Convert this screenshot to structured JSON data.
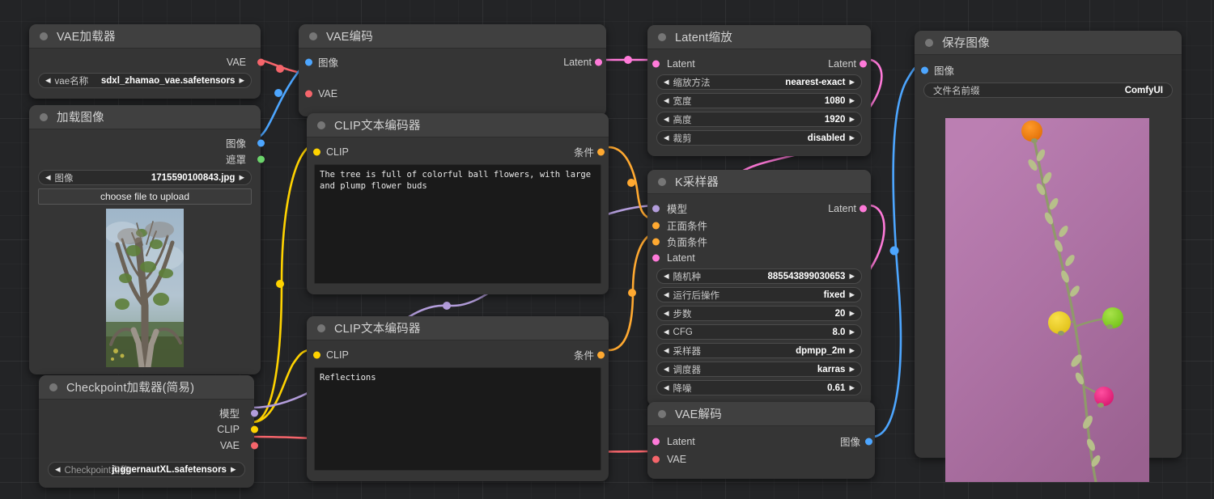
{
  "app": {
    "name": "ComfyUI",
    "canvas_bg": "#232426"
  },
  "colors": {
    "vae_red": "#f5656b",
    "image_blue": "#4da6ff",
    "mask_green": "#6bd46b",
    "latent_pink": "#ff7ad9",
    "clip_yellow": "#ffd300",
    "cond_orange": "#ffa931",
    "model_purple": "#b39ddb"
  },
  "nodes": [
    {
      "id": "vae-loader",
      "title": "VAE加载器",
      "outputs": [
        {
          "label": "VAE",
          "color": "#f5656b"
        }
      ],
      "inputs": [],
      "widgets": [
        {
          "label": "vae名称",
          "value": "sdxl_zhamao_vae.safetensors",
          "arrows": true
        }
      ]
    },
    {
      "id": "load-image",
      "title": "加载图像",
      "outputs": [
        {
          "label": "图像",
          "color": "#4da6ff"
        },
        {
          "label": "遮罩",
          "color": "#6bd46b"
        }
      ],
      "inputs": [],
      "widgets": [
        {
          "label": "图像",
          "value": "1715590100843.jpg",
          "arrows": true
        }
      ],
      "button": "choose file to upload",
      "preview": "tree-photo"
    },
    {
      "id": "checkpoint-loader",
      "title": "Checkpoint加载器(简易)",
      "inputs": [],
      "outputs": [
        {
          "label": "模型",
          "color": "#b39ddb"
        },
        {
          "label": "CLIP",
          "color": "#ffd300"
        },
        {
          "label": "VAE",
          "color": "#f5656b"
        }
      ],
      "widgets": [
        {
          "label": "Checkpoint名称",
          "value": "juggernautXL.safetensors",
          "arrows": true
        }
      ]
    },
    {
      "id": "vae-encode",
      "title": "VAE编码",
      "inputs": [
        {
          "label": "图像",
          "color": "#4da6ff"
        },
        {
          "label": "VAE",
          "color": "#f5656b"
        }
      ],
      "outputs": [
        {
          "label": "Latent",
          "color": "#ff7ad9"
        }
      ],
      "widgets": []
    },
    {
      "id": "clip-text-encode-positive",
      "title": "CLIP文本编码器",
      "inputs": [
        {
          "label": "CLIP",
          "color": "#ffd300"
        }
      ],
      "outputs": [
        {
          "label": "条件",
          "color": "#ffa931"
        }
      ],
      "text": "The tree is full of colorful ball flowers, with large and plump flower buds"
    },
    {
      "id": "clip-text-encode-negative",
      "title": "CLIP文本编码器",
      "inputs": [
        {
          "label": "CLIP",
          "color": "#ffd300"
        }
      ],
      "outputs": [
        {
          "label": "条件",
          "color": "#ffa931"
        }
      ],
      "text": "Reflections"
    },
    {
      "id": "latent-upscale",
      "title": "Latent缩放",
      "inputs": [
        {
          "label": "Latent",
          "color": "#ff7ad9"
        }
      ],
      "outputs": [
        {
          "label": "Latent",
          "color": "#ff7ad9"
        }
      ],
      "widgets": [
        {
          "label": "缩放方法",
          "value": "nearest-exact",
          "arrows": true
        },
        {
          "label": "宽度",
          "value": "1080",
          "arrows": true
        },
        {
          "label": "高度",
          "value": "1920",
          "arrows": true
        },
        {
          "label": "裁剪",
          "value": "disabled",
          "arrows": true
        }
      ]
    },
    {
      "id": "ksampler",
      "title": "K采样器",
      "inputs": [
        {
          "label": "模型",
          "color": "#b39ddb"
        },
        {
          "label": "正面条件",
          "color": "#ffa931"
        },
        {
          "label": "负面条件",
          "color": "#ffa931"
        },
        {
          "label": "Latent",
          "color": "#ff7ad9"
        }
      ],
      "outputs": [
        {
          "label": "Latent",
          "color": "#ff7ad9"
        }
      ],
      "widgets": [
        {
          "label": "随机种",
          "value": "885543899030653",
          "arrows": true
        },
        {
          "label": "运行后操作",
          "value": "fixed",
          "arrows": true
        },
        {
          "label": "步数",
          "value": "20",
          "arrows": true
        },
        {
          "label": "CFG",
          "value": "8.0",
          "arrows": true
        },
        {
          "label": "采样器",
          "value": "dpmpp_2m",
          "arrows": true
        },
        {
          "label": "调度器",
          "value": "karras",
          "arrows": true
        },
        {
          "label": "降噪",
          "value": "0.61",
          "arrows": true
        }
      ]
    },
    {
      "id": "vae-decode",
      "title": "VAE解码",
      "inputs": [
        {
          "label": "Latent",
          "color": "#ff7ad9"
        },
        {
          "label": "VAE",
          "color": "#f5656b"
        }
      ],
      "outputs": [
        {
          "label": "图像",
          "color": "#4da6ff"
        }
      ],
      "widgets": []
    },
    {
      "id": "save-image",
      "title": "保存图像",
      "inputs": [
        {
          "label": "图像",
          "color": "#4da6ff"
        }
      ],
      "outputs": [],
      "widgets": [
        {
          "label": "文件名前缀",
          "value": "ComfyUI",
          "arrows": false
        }
      ],
      "preview": "flower-branch-photo"
    }
  ]
}
